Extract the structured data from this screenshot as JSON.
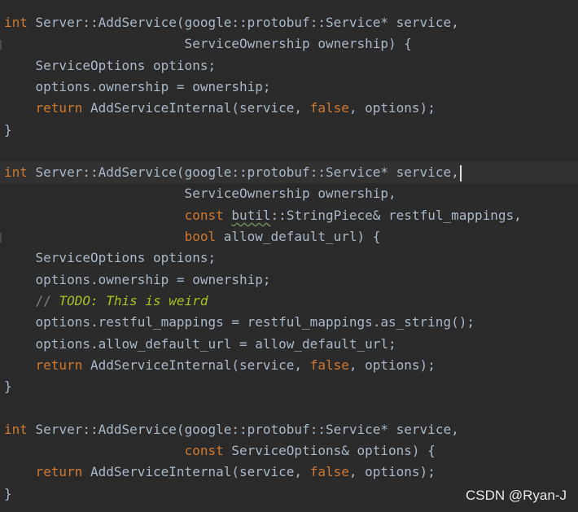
{
  "editor": {
    "lines": [
      {
        "tokens": [
          {
            "t": "int",
            "c": "kw"
          },
          {
            "t": " Server::AddService(google::protobuf::Service* service,",
            "c": "plain"
          }
        ]
      },
      {
        "tokens": [
          {
            "t": "                       ServiceOwnership ownership) {",
            "c": "plain"
          }
        ]
      },
      {
        "tokens": [
          {
            "t": "    ServiceOptions options;",
            "c": "plain"
          }
        ]
      },
      {
        "tokens": [
          {
            "t": "    options.ownership = ownership;",
            "c": "plain"
          }
        ]
      },
      {
        "tokens": [
          {
            "t": "    ",
            "c": "plain"
          },
          {
            "t": "return",
            "c": "kw"
          },
          {
            "t": " AddServiceInternal(service, ",
            "c": "plain"
          },
          {
            "t": "false",
            "c": "kw"
          },
          {
            "t": ", options);",
            "c": "plain"
          }
        ]
      },
      {
        "tokens": [
          {
            "t": "}",
            "c": "plain"
          }
        ]
      },
      {
        "tokens": [
          {
            "t": "",
            "c": "plain"
          }
        ]
      },
      {
        "tokens": [
          {
            "t": "int",
            "c": "kw"
          },
          {
            "t": " Server::AddService(google::protobuf::Service* service,",
            "c": "plain"
          }
        ]
      },
      {
        "tokens": [
          {
            "t": "                       ServiceOwnership ownership,",
            "c": "plain"
          }
        ]
      },
      {
        "tokens": [
          {
            "t": "                       ",
            "c": "plain"
          },
          {
            "t": "const",
            "c": "kw"
          },
          {
            "t": " ",
            "c": "plain"
          },
          {
            "t": "butil",
            "c": "ns"
          },
          {
            "t": "::StringPiece& restful_mappings,",
            "c": "plain"
          }
        ]
      },
      {
        "tokens": [
          {
            "t": "                       ",
            "c": "plain"
          },
          {
            "t": "bool",
            "c": "kw"
          },
          {
            "t": " allow_default_url) {",
            "c": "plain"
          }
        ]
      },
      {
        "tokens": [
          {
            "t": "    ServiceOptions options;",
            "c": "plain"
          }
        ]
      },
      {
        "tokens": [
          {
            "t": "    options.ownership = ownership;",
            "c": "plain"
          }
        ]
      },
      {
        "tokens": [
          {
            "t": "    ",
            "c": "plain"
          },
          {
            "t": "// ",
            "c": "comment"
          },
          {
            "t": "TODO: This is weird",
            "c": "todo"
          }
        ]
      },
      {
        "tokens": [
          {
            "t": "    options.restful_mappings = restful_mappings.as_string();",
            "c": "plain"
          }
        ]
      },
      {
        "tokens": [
          {
            "t": "    options.allow_default_url = allow_default_url;",
            "c": "plain"
          }
        ]
      },
      {
        "tokens": [
          {
            "t": "    ",
            "c": "plain"
          },
          {
            "t": "return",
            "c": "kw"
          },
          {
            "t": " AddServiceInternal(service, ",
            "c": "plain"
          },
          {
            "t": "false",
            "c": "kw"
          },
          {
            "t": ", options);",
            "c": "plain"
          }
        ]
      },
      {
        "tokens": [
          {
            "t": "}",
            "c": "plain"
          }
        ]
      },
      {
        "tokens": [
          {
            "t": "",
            "c": "plain"
          }
        ]
      },
      {
        "tokens": [
          {
            "t": "int",
            "c": "kw"
          },
          {
            "t": " Server::AddService(google::protobuf::Service* service,",
            "c": "plain"
          }
        ]
      },
      {
        "tokens": [
          {
            "t": "                       ",
            "c": "plain"
          },
          {
            "t": "const",
            "c": "kw"
          },
          {
            "t": " ServiceOptions& options) {",
            "c": "plain"
          }
        ]
      },
      {
        "tokens": [
          {
            "t": "    ",
            "c": "plain"
          },
          {
            "t": "return",
            "c": "kw"
          },
          {
            "t": " AddServiceInternal(service, ",
            "c": "plain"
          },
          {
            "t": "false",
            "c": "kw"
          },
          {
            "t": ", options);",
            "c": "plain"
          }
        ]
      },
      {
        "tokens": [
          {
            "t": "}",
            "c": "plain"
          }
        ]
      }
    ],
    "current_line_index": 7,
    "caret_line_index": 7
  },
  "colors": {
    "background": "#2b2b2b",
    "keyword": "#cc7832",
    "text": "#a9b7c6",
    "comment": "#808080",
    "todo": "#a8c023"
  },
  "watermark": {
    "text": "CSDN @Ryan-J"
  }
}
